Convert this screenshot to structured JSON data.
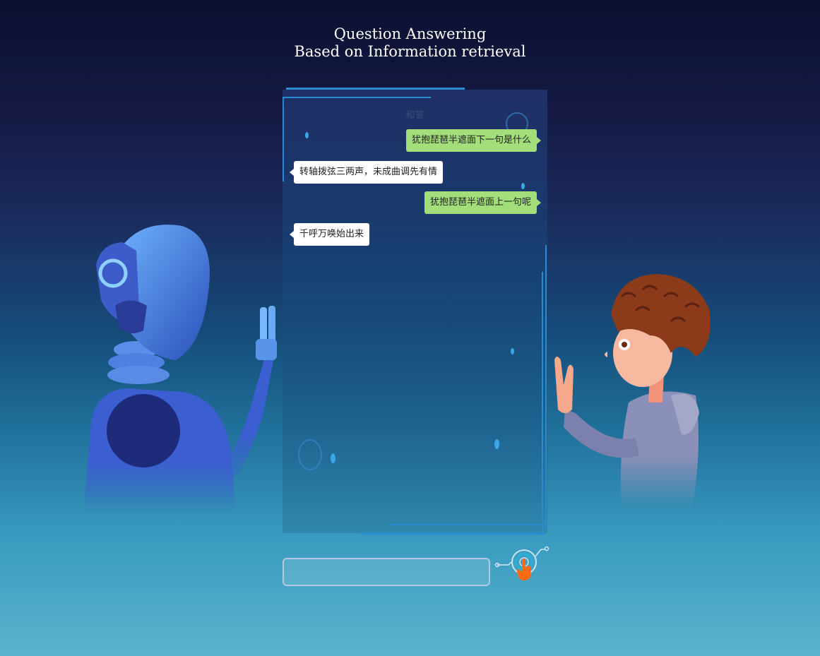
{
  "page": {
    "title_line1": "Question Answering",
    "title_line2": "Based on Information retrieval"
  },
  "chat": {
    "header": "和答",
    "messages": [
      {
        "side": "right",
        "text": "犹抱琵琶半遮面下一句是什么"
      },
      {
        "side": "left",
        "text": "转轴拨弦三两声，未成曲调先有情"
      },
      {
        "side": "right",
        "text": "犹抱琵琶半遮面上一句呢"
      },
      {
        "side": "left",
        "text": "千呼万唤始出来"
      }
    ]
  },
  "composer": {
    "input_value": "",
    "input_placeholder": "",
    "send_icon": "touch-hand-icon"
  },
  "colors": {
    "user_bubble": "#a2df7a",
    "bot_bubble": "#ffffff",
    "accent": "#2a8cd0",
    "send_hand": "#ff6a13"
  },
  "illustrations": [
    "robot",
    "curly-haired-boy"
  ]
}
